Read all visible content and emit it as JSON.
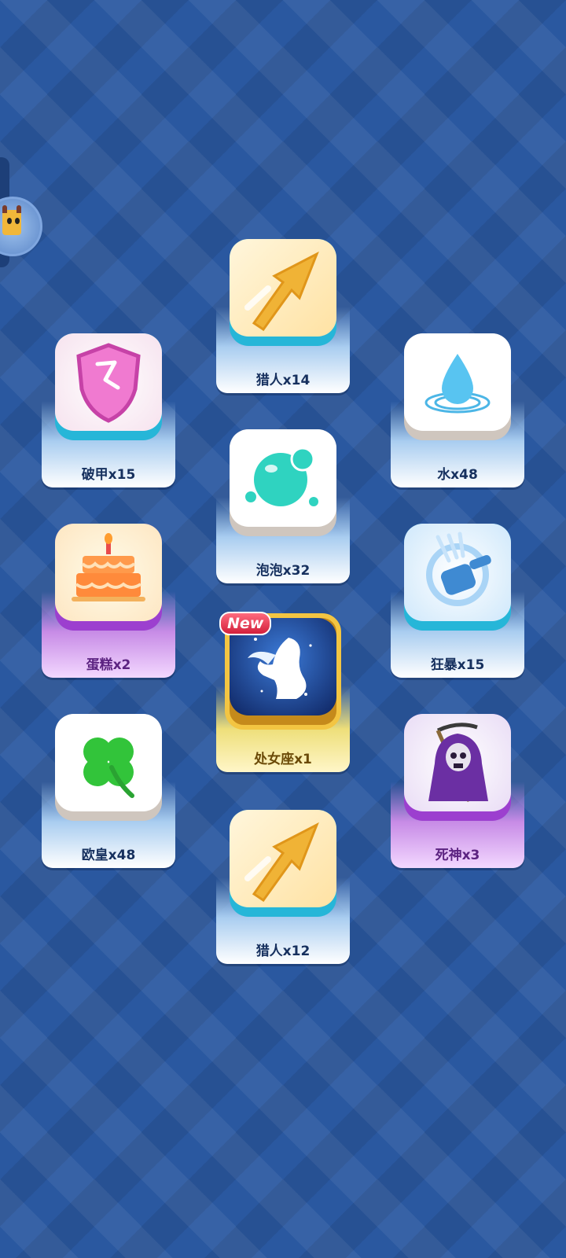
{
  "new_badge": "New",
  "cards": [
    {
      "id": "hunter-1",
      "label": "猎人x14",
      "icon": "arrow-icon",
      "theme": "blue"
    },
    {
      "id": "armor-break",
      "label": "破甲x15",
      "icon": "broken-shield-icon",
      "theme": "blue"
    },
    {
      "id": "water",
      "label": "水x48",
      "icon": "water-drop-icon",
      "theme": "blue"
    },
    {
      "id": "bubble",
      "label": "泡泡x32",
      "icon": "bubble-icon",
      "theme": "blue"
    },
    {
      "id": "cake",
      "label": "蛋糕x2",
      "icon": "cake-icon",
      "theme": "purple"
    },
    {
      "id": "berserk",
      "label": "狂暴x15",
      "icon": "hammer-icon",
      "theme": "blue"
    },
    {
      "id": "virgo",
      "label": "处女座x1",
      "icon": "virgo-silhouette-icon",
      "theme": "gold"
    },
    {
      "id": "lucky",
      "label": "欧皇x48",
      "icon": "clover-icon",
      "theme": "blue"
    },
    {
      "id": "death",
      "label": "死神x3",
      "icon": "reaper-icon",
      "theme": "purple"
    },
    {
      "id": "hunter-2",
      "label": "猎人x12",
      "icon": "arrow-icon",
      "theme": "blue"
    }
  ]
}
